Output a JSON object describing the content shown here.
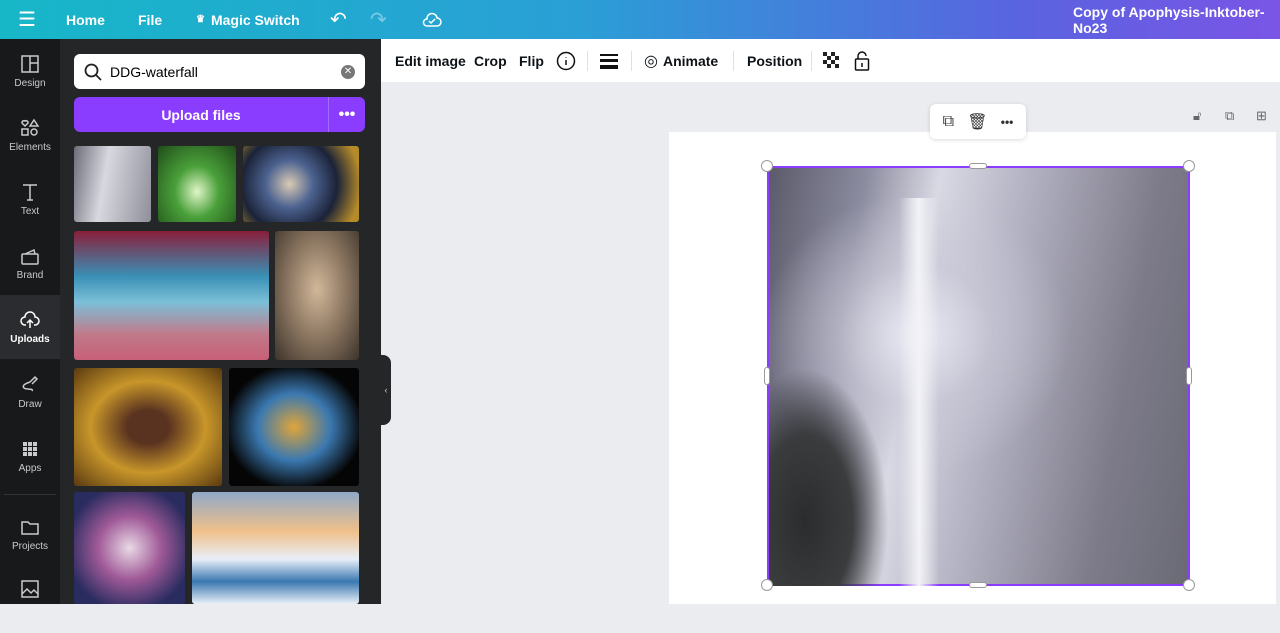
{
  "topbar": {
    "home": "Home",
    "file": "File",
    "magic_switch": "Magic Switch",
    "doc_title": "Copy of Apophysis-Inktober-No23"
  },
  "rail": [
    {
      "label": "Design",
      "icon": "layout-icon"
    },
    {
      "label": "Elements",
      "icon": "shapes-icon"
    },
    {
      "label": "Text",
      "icon": "text-icon"
    },
    {
      "label": "Brand",
      "icon": "brand-icon"
    },
    {
      "label": "Uploads",
      "icon": "cloud-upload-icon"
    },
    {
      "label": "Draw",
      "icon": "pen-icon"
    },
    {
      "label": "Apps",
      "icon": "grid-icon"
    },
    {
      "label": "Projects",
      "icon": "folder-icon"
    }
  ],
  "panel": {
    "search_value": "DDG-waterfall",
    "upload_label": "Upload files",
    "more": "•••"
  },
  "toolbar": {
    "edit_image": "Edit image",
    "crop": "Crop",
    "flip": "Flip",
    "animate": "Animate",
    "position": "Position"
  },
  "floating": {
    "more": "•••"
  },
  "colors": {
    "accent": "#8b3dff",
    "rail": "#18191b",
    "panel": "#252627"
  }
}
